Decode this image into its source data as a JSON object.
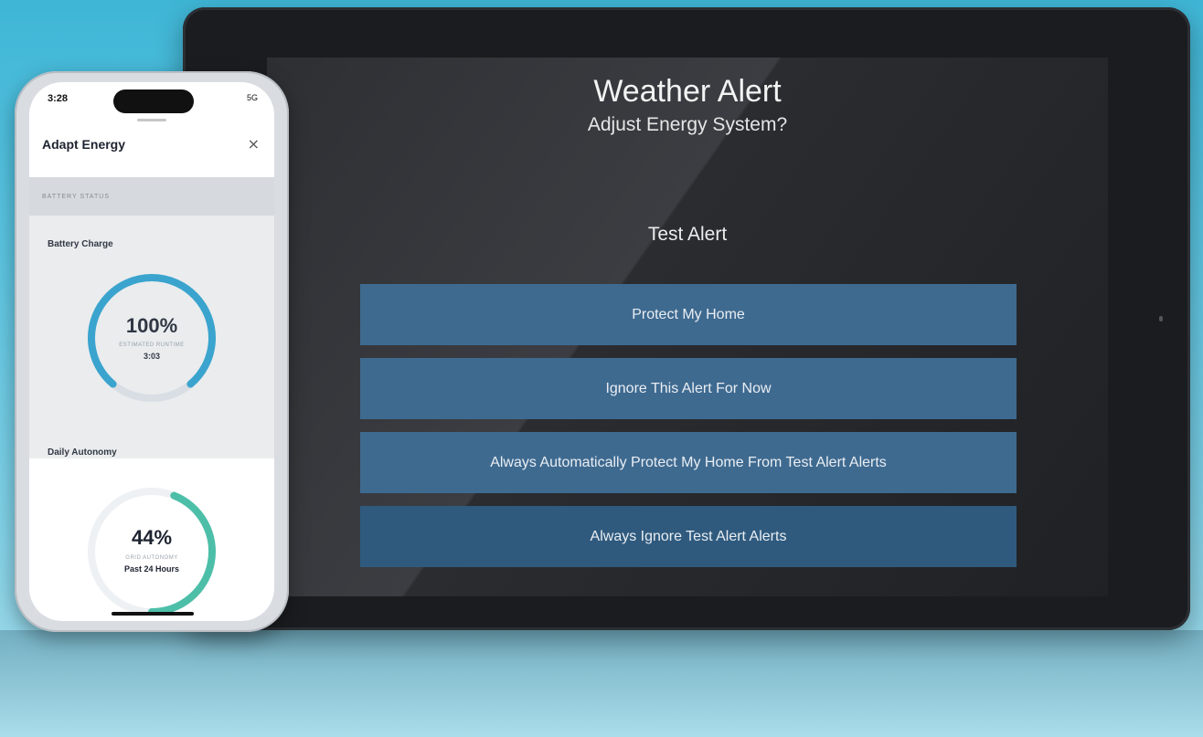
{
  "tablet": {
    "title": "Weather Alert",
    "subtitle": "Adjust Energy System?",
    "alert_name": "Test Alert",
    "buttons": [
      "Protect My Home",
      "Ignore This Alert For Now",
      "Always Automatically Protect My Home From Test Alert Alerts",
      "Always Ignore Test Alert Alerts"
    ]
  },
  "phone": {
    "status_time": "3:28",
    "status_right": "5G",
    "panel_title": "Adapt Energy",
    "close_symbol": "×",
    "section_label": "BATTERY STATUS",
    "battery": {
      "label": "Battery Charge",
      "value": "100%",
      "percent": 100,
      "sub": "ESTIMATED RUNTIME",
      "detail": "3:03",
      "color": "#29a8d8"
    },
    "autonomy": {
      "label": "Daily Autonomy",
      "value": "44%",
      "percent": 44,
      "sub": "GRID AUTONOMY",
      "detail": "Past 24 Hours",
      "color": "#4dbfa8"
    }
  },
  "colors": {
    "button": "#3f6a90",
    "background": "#5cc4e0"
  }
}
